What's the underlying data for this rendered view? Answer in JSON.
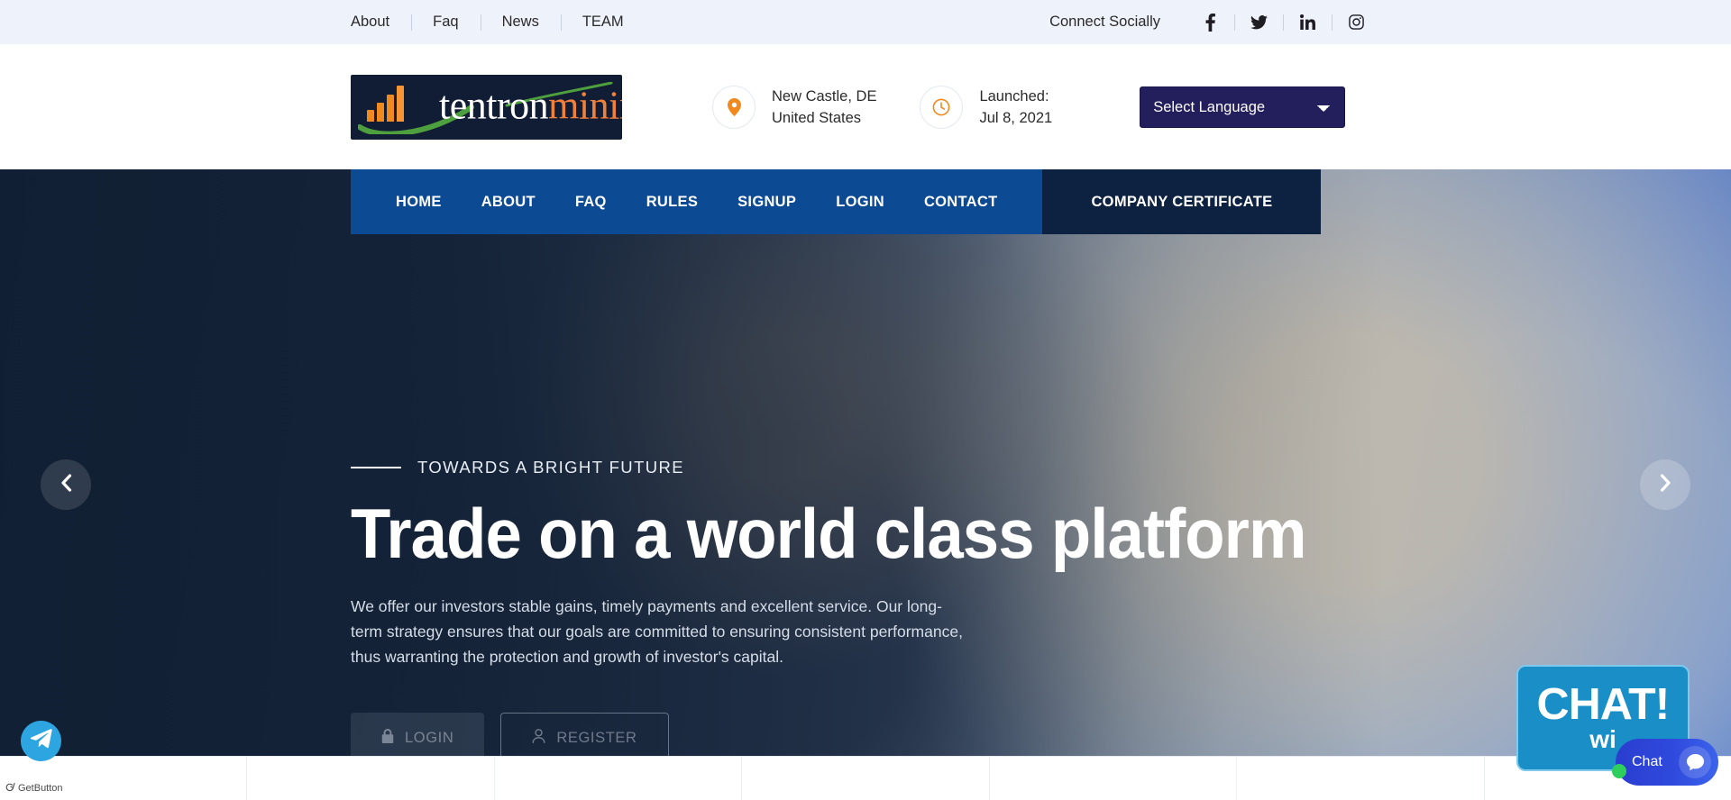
{
  "topbar": {
    "links": [
      {
        "label": "About"
      },
      {
        "label": "Faq"
      },
      {
        "label": "News"
      },
      {
        "label": "TEAM"
      }
    ],
    "connect_label": "Connect Socially",
    "socials": [
      {
        "name": "facebook-icon"
      },
      {
        "name": "twitter-icon"
      },
      {
        "name": "linkedin-icon"
      },
      {
        "name": "instagram-icon"
      }
    ]
  },
  "header": {
    "logo": {
      "text_primary": "tentron",
      "text_secondary": "mining",
      "bg_color": "#111c35",
      "accent_color": "#f08a1e",
      "swoosh_color": "#4e9f3d"
    },
    "meta": [
      {
        "icon": "map-pin-icon",
        "line1": "New Castle, DE",
        "line2": "United States"
      },
      {
        "icon": "clock-icon",
        "line1": "Launched:",
        "line2": "Jul 8, 2021"
      }
    ],
    "language": {
      "selected": "Select Language",
      "options": [
        "Select Language"
      ],
      "bg_color": "#231f5c"
    }
  },
  "nav": {
    "items": [
      {
        "label": "HOME"
      },
      {
        "label": "ABOUT"
      },
      {
        "label": "FAQ"
      },
      {
        "label": "RULES"
      },
      {
        "label": "SIGNUP"
      },
      {
        "label": "LOGIN"
      },
      {
        "label": "CONTACT"
      }
    ],
    "certificate_label": "COMPANY CERTIFICATE",
    "bar_color": "#0c4a93",
    "certificate_color": "#0d2240"
  },
  "hero": {
    "eyebrow": "TOWARDS A BRIGHT FUTURE",
    "title": "Trade on a world class platform",
    "paragraph": "We offer our investors stable gains, timely payments and excellent service. Our long-term strategy ensures that our goals are committed to ensuring consistent performance, thus warranting the protection and growth of investor's capital.",
    "buttons": [
      {
        "label": "LOGIN",
        "icon": "lock-icon"
      },
      {
        "label": "REGISTER",
        "icon": "user-icon"
      }
    ],
    "carousel": {
      "prev": "chevron-left-icon",
      "next": "chevron-right-icon"
    }
  },
  "widgets": {
    "telegram": {
      "icon": "telegram-icon",
      "color": "#2ca5e0"
    },
    "getbutton": {
      "label": "GetButton"
    },
    "chat_banner": {
      "line1": "CHAT!",
      "line2": "wi",
      "color": "#1a8fc7"
    },
    "chat_pill": {
      "label": "Chat",
      "icon": "chat-bubble-icon",
      "status_color": "#2fcf5d"
    }
  }
}
